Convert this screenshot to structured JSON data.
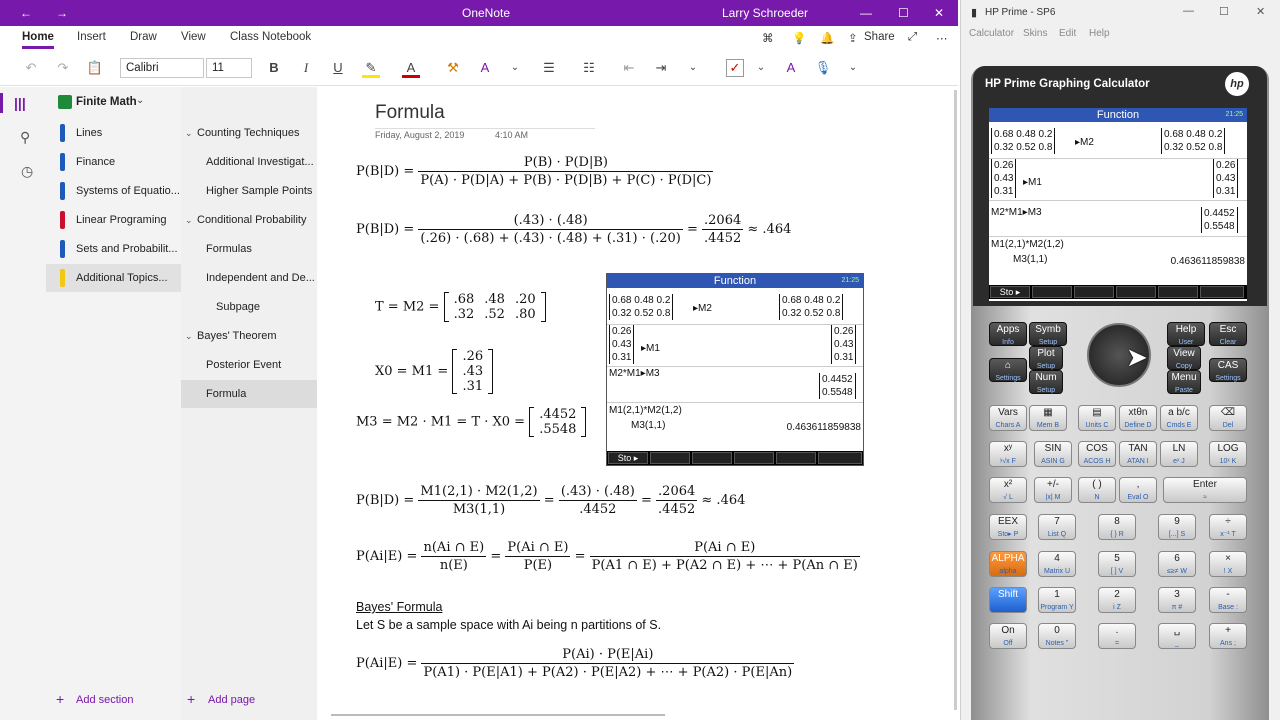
{
  "onenote": {
    "title": "OneNote",
    "user": "Larry Schroeder",
    "tabs": [
      "Home",
      "Insert",
      "Draw",
      "View",
      "Class Notebook"
    ],
    "share": "Share",
    "font": "Calibri",
    "size": "11",
    "notebook": "Finite Math",
    "sections": [
      {
        "label": "Lines",
        "color": "#1e5bb8"
      },
      {
        "label": "Finance",
        "color": "#1e5bb8"
      },
      {
        "label": "Systems of Equatio...",
        "color": "#1e5bb8"
      },
      {
        "label": "Linear Programing",
        "color": "#c8102e"
      },
      {
        "label": "Sets and Probabilit...",
        "color": "#1e5bb8"
      },
      {
        "label": "Additional Topics...",
        "color": "#f2c811"
      }
    ],
    "pages": [
      {
        "label": "Counting Techniques",
        "lvl": 0,
        "chev": "⌄"
      },
      {
        "label": "Additional Investigat...",
        "lvl": 1
      },
      {
        "label": "Higher Sample Points",
        "lvl": 1
      },
      {
        "label": "Conditional Probability",
        "lvl": 0,
        "chev": "⌄"
      },
      {
        "label": "Formulas",
        "lvl": 1
      },
      {
        "label": "Independent and De...",
        "lvl": 1
      },
      {
        "label": "Subpage",
        "lvl": 2
      },
      {
        "label": "Bayes' Theorem",
        "lvl": 0,
        "chev": "⌄"
      },
      {
        "label": "Posterior Event",
        "lvl": 1
      },
      {
        "label": "Formula",
        "lvl": 1,
        "sel": true
      }
    ],
    "add_section": "Add section",
    "add_page": "Add page",
    "page_title": "Formula",
    "page_date": "Friday, August 2, 2019",
    "page_time": "4:10 AM",
    "bayes_heading": "Bayes' Formula",
    "bayes_text": "Let S be a sample space with Ai being n partitions of S."
  },
  "math": {
    "m1_lhs": "P(B|D) =",
    "m1_num": "P(B) · P(D|B)",
    "m1_den": "P(A) · P(D|A) + P(B) · P(D|B) + P(C) · P(D|C)",
    "m2_lhs": "P(B|D) =",
    "m2_num": "(.43) · (.48)",
    "m2_den": "(.26) · (.68) + (.43) · (.48) + (.31) · (.20)",
    "m2_eq": "=",
    "m2_rn": ".2064",
    "m2_rd": ".4452",
    "m2_approx": "≈ .464",
    "t_lhs": "T = M2 =",
    "t_rows": [
      [
        ".68",
        ".48",
        ".20"
      ],
      [
        ".32",
        ".52",
        ".80"
      ]
    ],
    "x_lhs": "X0 = M1 =",
    "x_rows": [
      [
        ".26"
      ],
      [
        ".43"
      ],
      [
        ".31"
      ]
    ],
    "m3_lhs": "M3 = M2 · M1 = T · X0 =",
    "m3_rows": [
      [
        ".4452"
      ],
      [
        ".5548"
      ]
    ],
    "c_lhs": "P(B|D) =",
    "c_num": "M1(2,1) · M2(1,2)",
    "c_den": "M3(1,1)",
    "c_eq": "=",
    "c_n2": "(.43) · (.48)",
    "c_d2": ".4452",
    "c_eq2": "=",
    "c_n3": ".2064",
    "c_d3": ".4452",
    "c_approx": "≈ .464",
    "p_lhs": "P(Ai|E) =",
    "p_n1": "n(Ai ∩ E)",
    "p_d1": "n(E)",
    "p_eq": "=",
    "p_n2": "P(Ai ∩ E)",
    "p_d2": "P(E)",
    "p_eq2": "=",
    "p_n3": "P(Ai ∩ E)",
    "p_d3": "P(A1 ∩ E) + P(A2 ∩ E) + ⋯ + P(An ∩ E)",
    "b_lhs": "P(Ai|E) =",
    "b_num": "P(Ai) · P(E|Ai)",
    "b_den": "P(A1) · P(E|A1) + P(A2) · P(E|A2) + ⋯ + P(A2) · P(E|An)"
  },
  "screen": {
    "header": "Function",
    "clock": "21:25",
    "m2_rows": [
      [
        "0.68",
        "0.48",
        "0.2"
      ],
      [
        "0.32",
        "0.52",
        "0.8"
      ]
    ],
    "m2_store": "▸M2",
    "m1_rows": [
      "0.26",
      "0.43",
      "0.31"
    ],
    "m1_store": "▸M1",
    "m3_cmd": "M2*M1▸M3",
    "m3_rows": [
      "0.4452",
      "0.5548"
    ],
    "c_cmd1": "M1(2,1)*M2(1,2)",
    "c_cmd2": "M3(1,1)",
    "c_res": "0.463611859838",
    "softkey": "Sto ▸"
  },
  "calc": {
    "win_title": "HP Prime - SP6",
    "menu": [
      "Calculator",
      "Skins",
      "Edit",
      "Help"
    ],
    "brand": "HP Prime Graphing Calculator",
    "logo": "hp",
    "keys": [
      {
        "m": "Apps",
        "s": "Info",
        "d": 1
      },
      {
        "m": "Symb",
        "s": "Setup",
        "d": 1
      },
      {
        "m": "Help",
        "s": "User",
        "d": 1
      },
      {
        "m": "Esc",
        "s": "Clear",
        "d": 1
      },
      {
        "m": "⌂",
        "s": "Settings",
        "d": 1
      },
      {
        "m": "Plot",
        "s": "Setup",
        "d": 1
      },
      {
        "m": "View",
        "s": "Copy",
        "d": 1
      },
      {
        "m": "CAS",
        "s": "Settings",
        "d": 1
      },
      {
        "m": "Num",
        "s": "Setup",
        "d": 1
      },
      {
        "m": "Menu",
        "s": "Paste",
        "d": 1
      },
      {
        "m": "Vars",
        "s": "Chars A"
      },
      {
        "m": "▦",
        "s": "Mem B"
      },
      {
        "m": "▤",
        "s": "Units C"
      },
      {
        "m": "xtθn",
        "s": "Define D"
      },
      {
        "m": "a b/c",
        "s": "Cmds E"
      },
      {
        "m": "⌫",
        "s": "Del"
      },
      {
        "m": "xʸ",
        "s": "ʸ√x F"
      },
      {
        "m": "SIN",
        "s": "ASIN G"
      },
      {
        "m": "COS",
        "s": "ACOS H"
      },
      {
        "m": "TAN",
        "s": "ATAN I"
      },
      {
        "m": "LN",
        "s": "eˣ J"
      },
      {
        "m": "LOG",
        "s": "10ˣ K"
      },
      {
        "m": "x²",
        "s": "√ L"
      },
      {
        "m": "+/-",
        "s": "|x| M"
      },
      {
        "m": "( )",
        "s": "N"
      },
      {
        "m": ",",
        "s": "Eval O"
      },
      {
        "m": "Enter",
        "s": "≈"
      },
      {
        "m": "EEX",
        "s": "Sto▸ P"
      },
      {
        "m": "7",
        "s": "List Q"
      },
      {
        "m": "8",
        "s": "{ } R"
      },
      {
        "m": "9",
        "s": "[...] S"
      },
      {
        "m": "÷",
        "s": "x⁻¹ T"
      },
      {
        "m": "ALPHA",
        "s": "alpha"
      },
      {
        "m": "4",
        "s": "Matrix U"
      },
      {
        "m": "5",
        "s": "[ ] V"
      },
      {
        "m": "6",
        "s": "≤≥≠ W"
      },
      {
        "m": "×",
        "s": "! X"
      },
      {
        "m": "Shift",
        "s": ""
      },
      {
        "m": "1",
        "s": "Program Y"
      },
      {
        "m": "2",
        "s": "i Z"
      },
      {
        "m": "3",
        "s": "π #"
      },
      {
        "m": "-",
        "s": "Base :"
      },
      {
        "m": "On",
        "s": "Off"
      },
      {
        "m": "0",
        "s": "Notes \""
      },
      {
        "m": ".",
        "s": "="
      },
      {
        "m": "␣",
        "s": "_"
      },
      {
        "m": "+",
        "s": "Ans ;"
      }
    ]
  },
  "colors": {
    "onenote": "#7719aa",
    "screen_header": "#2f56b3"
  }
}
